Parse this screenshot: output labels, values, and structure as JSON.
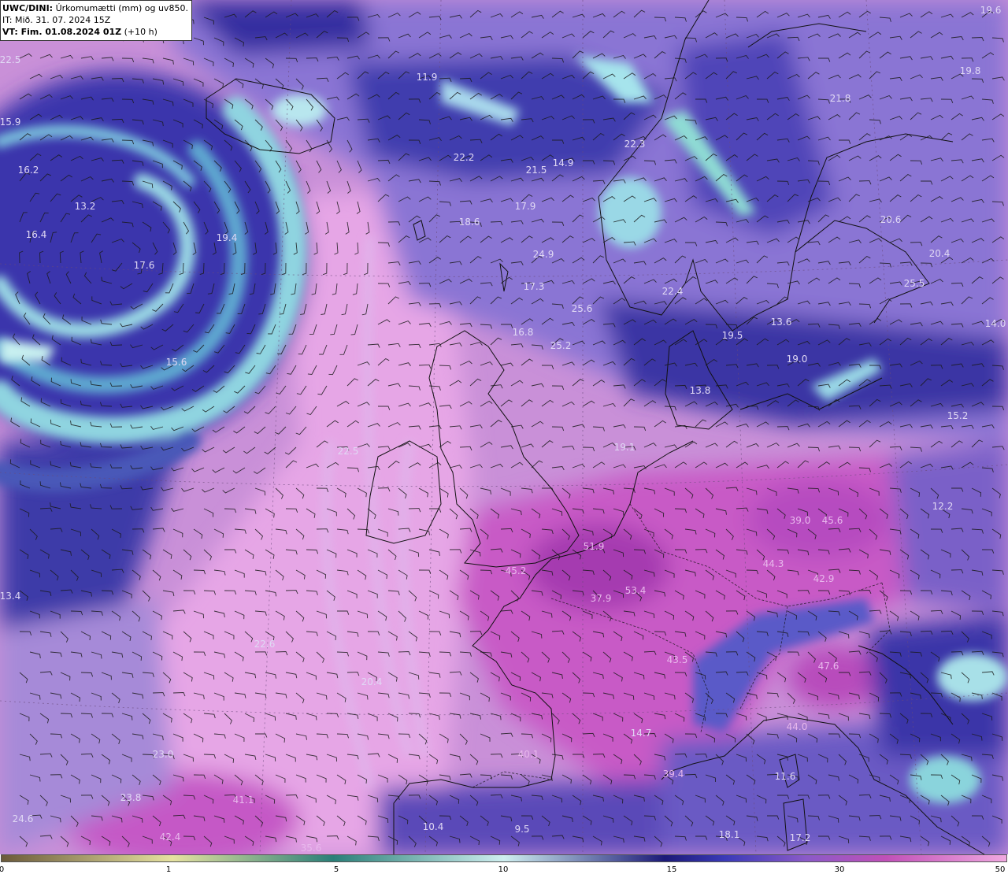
{
  "header": {
    "model": "UWC/DINI:",
    "title_rest": "Úrkomumætti (mm) og uv850.",
    "init_line": "IT: Mið. 31. 07. 2024 15Z",
    "valid_prefix": "VT: Fim. 01.08.2024 01Z",
    "valid_suffix": "(+10 h)"
  },
  "colors": {
    "low_brown": "#6b5a3a",
    "yellow": "#e6e2a0",
    "teal": "#2a7f78",
    "light_blue": "#cfeff0",
    "navy": "#1c1a78",
    "blue": "#3a3ab8",
    "purple": "#8a5ac8",
    "magenta": "#c050b8",
    "pink": "#f0a8e0"
  },
  "colorbar": {
    "ticks": [
      "0",
      "1",
      "5",
      "10",
      "15",
      "30",
      "50"
    ]
  },
  "values": [
    {
      "text": "19.6"
    },
    {
      "text": "22.5"
    },
    {
      "text": "11.9"
    },
    {
      "text": "15.9"
    },
    {
      "text": "19.8"
    },
    {
      "text": "21.8"
    },
    {
      "text": "22.2"
    },
    {
      "text": "22.3"
    },
    {
      "text": "21.5"
    },
    {
      "text": "14.9"
    },
    {
      "text": "16.2"
    },
    {
      "text": "13.2"
    },
    {
      "text": "17.9"
    },
    {
      "text": "18.6"
    },
    {
      "text": "16.4"
    },
    {
      "text": "19.4"
    },
    {
      "text": "20.6"
    },
    {
      "text": "24.9"
    },
    {
      "text": "17.6"
    },
    {
      "text": "20.4"
    },
    {
      "text": "17.3"
    },
    {
      "text": "22.4"
    },
    {
      "text": "25.5"
    },
    {
      "text": "25.6"
    },
    {
      "text": "13.6"
    },
    {
      "text": "14.0"
    },
    {
      "text": "16.8"
    },
    {
      "text": "19.5"
    },
    {
      "text": "25.2"
    },
    {
      "text": "19.0"
    },
    {
      "text": "15.6"
    },
    {
      "text": "13.8"
    },
    {
      "text": "15.2"
    },
    {
      "text": "22.5"
    },
    {
      "text": "19.1"
    },
    {
      "text": "12.2"
    },
    {
      "text": "39.0"
    },
    {
      "text": "45.6"
    },
    {
      "text": "51.9"
    },
    {
      "text": "45.2"
    },
    {
      "text": "44.3"
    },
    {
      "text": "42.9"
    },
    {
      "text": "13.4"
    },
    {
      "text": "53.4"
    },
    {
      "text": "37.9"
    },
    {
      "text": "22.6"
    },
    {
      "text": "43.5"
    },
    {
      "text": "47.6"
    },
    {
      "text": "20.4"
    },
    {
      "text": "44.0"
    },
    {
      "text": "14.7"
    },
    {
      "text": "23.0"
    },
    {
      "text": "40.1"
    },
    {
      "text": "39.4"
    },
    {
      "text": "11.6"
    },
    {
      "text": "23.8"
    },
    {
      "text": "41.1"
    },
    {
      "text": "24.6"
    },
    {
      "text": "10.4"
    },
    {
      "text": "9.5"
    },
    {
      "text": "42.4"
    },
    {
      "text": "18.1"
    },
    {
      "text": "17.2"
    },
    {
      "text": "35.6"
    }
  ]
}
